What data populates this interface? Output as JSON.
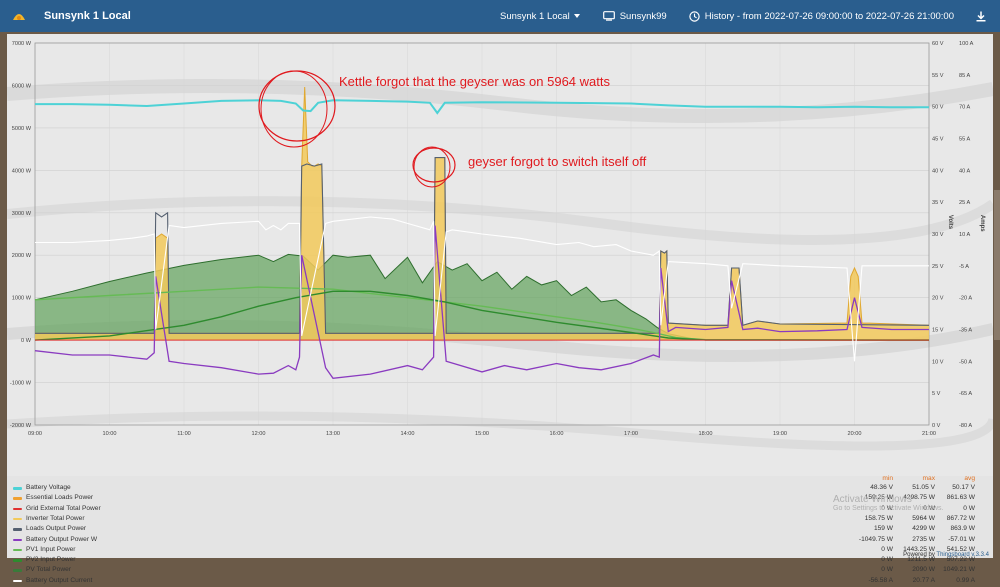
{
  "header": {
    "app_title": "Sunsynk 1 Local",
    "device_label": "Sunsynk 1 Local",
    "user_label": "Sunsynk99",
    "history_label": "History - from 2022-07-26 09:00:00 to 2022-07-26 21:00:00"
  },
  "annotations": {
    "kettle": "Kettle forgot that the geyser was on 5964 watts",
    "geyser": "geyser forgot to switch itself off"
  },
  "watermark": {
    "line1": "Activate Windows",
    "line2": "Go to Settings to activate Windows."
  },
  "footer": {
    "powered_prefix": "Powered by ",
    "powered_brand": "Thingsboard v.3.3.4"
  },
  "legend_headers": {
    "min": "min",
    "max": "max",
    "avg": "avg"
  },
  "legend": [
    {
      "name": "Battery Voltage",
      "color": "#4dd2d6",
      "min": "48.36 V",
      "max": "51.05 V",
      "avg": "50.17 V"
    },
    {
      "name": "Essential Loads Power",
      "color": "#f0a030",
      "min": "159.25 W",
      "max": "4298.75 W",
      "avg": "861.63 W"
    },
    {
      "name": "Grid External Total Power",
      "color": "#e03030",
      "min": "0 W",
      "max": "0 W",
      "avg": "0 W"
    },
    {
      "name": "Inverter Total Power",
      "color": "#f2c95a",
      "min": "158.75 W",
      "max": "5964 W",
      "avg": "867.72 W"
    },
    {
      "name": "Loads Output Power",
      "color": "#556070",
      "min": "159 W",
      "max": "4299 W",
      "avg": "863.9 W"
    },
    {
      "name": "Battery Output Power W",
      "color": "#8a3bc0",
      "min": "-1049.75 W",
      "max": "2735 W",
      "avg": "-57.01 W"
    },
    {
      "name": "PV1 Input Power",
      "color": "#66bb55",
      "min": "0 W",
      "max": "1443.25 W",
      "avg": "541.52 W"
    },
    {
      "name": "PV2 Input Power",
      "color": "#2e8b2e",
      "min": "0 W",
      "max": "1211.5 W",
      "avg": "507.22 W"
    },
    {
      "name": "PV Total Power",
      "color": "#3a7a3a",
      "min": "0 W",
      "max": "2090 W",
      "avg": "1049.21 W"
    },
    {
      "name": "Battery Output Current",
      "color": "#ffffff",
      "min": "-56.58 A",
      "max": "20.77 A",
      "avg": "0.99 A"
    }
  ],
  "chart_data": {
    "type": "area",
    "x_ticks": [
      "09:00",
      "10:00",
      "11:00",
      "12:00",
      "13:00",
      "14:00",
      "15:00",
      "16:00",
      "17:00",
      "18:00",
      "19:00",
      "20:00",
      "21:00"
    ],
    "y_left_ticks": [
      "7000 W",
      "6000 W",
      "5000 W",
      "4000 W",
      "3000 W",
      "2000 W",
      "1000 W",
      "0 W",
      "-1000 W",
      "-2000 W"
    ],
    "y_volts_ticks": [
      "60 V",
      "55 V",
      "50 V",
      "45 V",
      "40 V",
      "35 V",
      "30 V",
      "25 V",
      "20 V",
      "15 V",
      "10 V",
      "5 V",
      "0 V"
    ],
    "y_amps_ticks": [
      "100 A",
      "85 A",
      "70 A",
      "55 A",
      "40 A",
      "25 A",
      "10 A",
      "-5 A",
      "-20 A",
      "-35 A",
      "-50 A",
      "-65 A",
      "-80 A"
    ],
    "y_volts_label": "Volts",
    "y_amps_label": "Amps",
    "ylim_w": [
      -2000,
      7000
    ],
    "ylim_v": [
      0,
      60
    ],
    "ylim_a": [
      -80,
      100
    ],
    "xlim_h": [
      9,
      21
    ],
    "series": [
      {
        "name": "PV Total Power",
        "color": "#3a7a3a",
        "x": [
          9,
          9.5,
          10,
          10.5,
          11,
          11.5,
          12,
          12.2,
          12.4,
          12.6,
          12.8,
          13,
          13.2,
          13.5,
          13.7,
          14,
          14.2,
          14.4,
          14.6,
          14.8,
          15,
          15.2,
          15.4,
          15.6,
          15.8,
          16,
          16.2,
          16.4,
          16.6,
          16.8,
          17,
          17.2,
          17.35,
          17.5,
          17.8,
          18,
          21
        ],
        "y": [
          950,
          1150,
          1380,
          1580,
          1760,
          1900,
          2000,
          1850,
          2020,
          1980,
          1650,
          2000,
          1950,
          2000,
          1450,
          1950,
          1350,
          1850,
          1650,
          1800,
          1400,
          1600,
          1200,
          1500,
          1300,
          1400,
          1050,
          1250,
          900,
          950,
          700,
          500,
          300,
          150,
          40,
          0,
          0
        ]
      },
      {
        "name": "PV1 Input Power",
        "color": "#66bb55",
        "x": [
          9,
          10,
          11,
          12,
          13,
          14,
          15,
          16,
          16.5,
          17,
          17.3,
          17.6,
          18,
          21
        ],
        "y": [
          950,
          1050,
          1150,
          1250,
          1200,
          1000,
          800,
          550,
          430,
          280,
          180,
          60,
          10,
          0
        ]
      },
      {
        "name": "PV2 Input Power",
        "color": "#2e8b2e",
        "x": [
          9,
          10,
          11,
          11.5,
          12,
          12.5,
          13,
          13.5,
          14,
          14.5,
          15,
          16,
          17,
          17.5,
          18,
          21
        ],
        "y": [
          0,
          100,
          350,
          550,
          800,
          1000,
          1150,
          1150,
          1050,
          900,
          700,
          420,
          180,
          50,
          5,
          0
        ]
      },
      {
        "name": "Inverter Total Power",
        "color": "#f2c95a",
        "x": [
          9,
          10.6,
          10.62,
          10.7,
          10.78,
          10.8,
          12,
          12.55,
          12.58,
          12.62,
          12.66,
          12.72,
          12.75,
          12.8,
          12.85,
          12.9,
          13,
          14.35,
          14.37,
          14.4,
          14.45,
          14.5,
          14.52,
          17.38,
          17.4,
          17.45,
          17.48,
          17.5,
          18,
          18.3,
          18.35,
          18.45,
          18.5,
          18.7,
          19,
          19.8,
          19.9,
          19.95,
          20,
          20.05,
          20.1,
          20.2,
          21
        ],
        "y": [
          160,
          160,
          2400,
          2500,
          2400,
          160,
          160,
          160,
          4100,
          5964,
          4200,
          4100,
          4100,
          4150,
          4100,
          160,
          160,
          160,
          4300,
          4300,
          4300,
          4300,
          160,
          160,
          2100,
          2050,
          2100,
          400,
          350,
          350,
          1700,
          1700,
          350,
          450,
          380,
          400,
          400,
          1500,
          1700,
          1500,
          400,
          400,
          350
        ]
      },
      {
        "name": "Loads Output Power",
        "color": "#556070",
        "x": [
          9,
          10.6,
          10.62,
          10.7,
          10.78,
          10.8,
          12,
          12.55,
          12.58,
          12.65,
          12.75,
          12.85,
          12.9,
          13,
          14.35,
          14.37,
          14.4,
          14.45,
          14.5,
          14.52,
          17.38,
          17.4,
          17.45,
          17.48,
          17.5,
          18,
          18.3,
          18.35,
          18.45,
          18.5,
          18.7,
          19,
          21
        ],
        "y": [
          160,
          160,
          3000,
          2900,
          3000,
          160,
          160,
          160,
          4100,
          4150,
          4100,
          4150,
          160,
          160,
          160,
          4300,
          4300,
          4300,
          4300,
          160,
          160,
          2100,
          2050,
          2100,
          400,
          350,
          350,
          1700,
          1700,
          350,
          450,
          380,
          350
        ]
      },
      {
        "name": "Battery Output Power W",
        "color": "#8a3bc0",
        "x": [
          9,
          9.5,
          10,
          10.5,
          10.6,
          10.62,
          10.8,
          11,
          11.5,
          12,
          12.2,
          12.4,
          12.5,
          12.55,
          12.58,
          12.9,
          13,
          13.5,
          14,
          14.2,
          14.35,
          14.37,
          14.52,
          15,
          15.3,
          15.6,
          16,
          16.3,
          16.6,
          17,
          17.3,
          17.38,
          17.4,
          17.5,
          17.6,
          18,
          18.3,
          18.35,
          18.5,
          18.7,
          19,
          19.5,
          19.9,
          20,
          20.1,
          20.5,
          21
        ],
        "y": [
          -250,
          -350,
          -350,
          -450,
          -300,
          1500,
          -500,
          -550,
          -650,
          -800,
          -780,
          -600,
          -700,
          -400,
          2000,
          -650,
          -900,
          -800,
          -600,
          -700,
          -400,
          2700,
          -500,
          -750,
          -600,
          -700,
          -550,
          -650,
          -700,
          -550,
          -350,
          -400,
          1700,
          200,
          300,
          250,
          300,
          1400,
          250,
          280,
          200,
          220,
          250,
          1000,
          300,
          250,
          250
        ]
      },
      {
        "name": "Battery Voltage",
        "color": "#4dd2d6",
        "x": [
          9,
          9.5,
          10,
          10.5,
          11,
          11.5,
          12,
          12.3,
          12.5,
          12.6,
          12.7,
          12.8,
          13,
          13.5,
          14,
          14.3,
          14.4,
          14.5,
          15,
          16,
          17,
          17.5,
          18,
          19,
          19.5,
          20,
          20.5,
          21
        ],
        "y": [
          50.4,
          50.4,
          50.3,
          50.1,
          50.5,
          50.9,
          51.0,
          50.9,
          50.5,
          49.4,
          49.3,
          50.6,
          51.0,
          50.9,
          50.8,
          50.6,
          49.0,
          50.6,
          50.7,
          50.6,
          50.5,
          50.2,
          50.0,
          50.0,
          49.9,
          50.0,
          49.9,
          49.9
        ]
      },
      {
        "name": "Battery Output Current",
        "color": "#ffffff",
        "x": [
          9,
          9.5,
          10,
          10.3,
          10.5,
          10.6,
          10.62,
          10.8,
          11,
          11.5,
          12,
          12.1,
          12.2,
          12.3,
          12.4,
          12.55,
          12.58,
          12.9,
          13,
          13.5,
          13.8,
          14,
          14.3,
          14.35,
          14.37,
          14.52,
          14.6,
          15,
          15.5,
          16,
          16.3,
          16.5,
          16.8,
          17,
          17.3,
          17.38,
          17.4,
          17.5,
          18,
          18.3,
          18.35,
          18.5,
          19,
          19.9,
          20,
          20.1,
          21
        ],
        "y": [
          6,
          6,
          7,
          8,
          9,
          10,
          -35,
          14,
          13,
          15,
          16,
          12,
          14,
          12,
          15,
          15,
          -38,
          15,
          16,
          18,
          17,
          15,
          12,
          16,
          -38,
          11,
          12,
          10,
          8,
          5,
          6,
          4,
          5,
          2,
          0,
          2,
          -33,
          -3,
          -4,
          -5,
          -25,
          -4,
          -5,
          -6,
          -50,
          -5,
          -5
        ]
      }
    ]
  }
}
